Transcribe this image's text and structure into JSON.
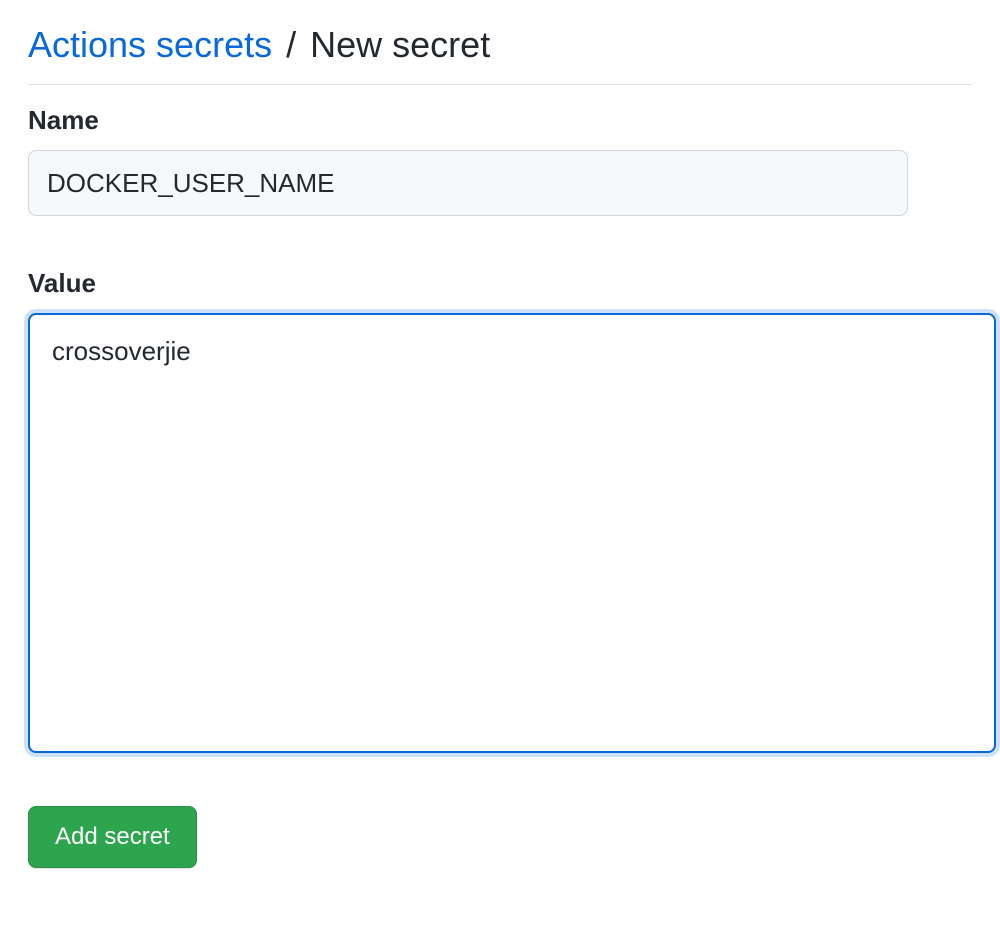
{
  "breadcrumb": {
    "link_label": "Actions secrets",
    "separator": "/",
    "current": "New secret"
  },
  "form": {
    "name_label": "Name",
    "name_value": "DOCKER_USER_NAME",
    "value_label": "Value",
    "value_text": "crossoverjie",
    "submit_label": "Add secret"
  }
}
